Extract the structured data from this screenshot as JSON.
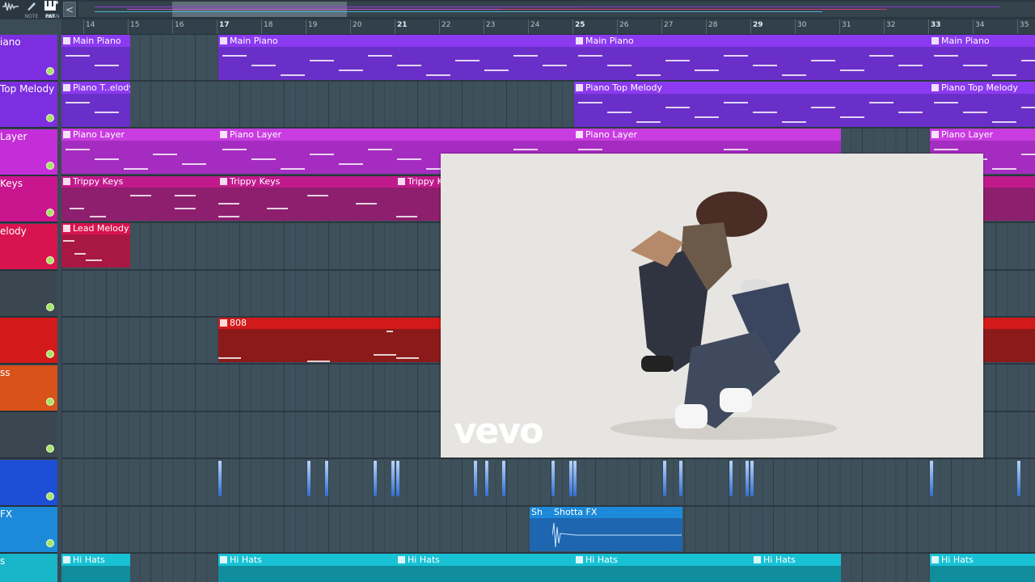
{
  "toolbar": {
    "modes": [
      {
        "key": "wave",
        "caption": "",
        "icon": "waveform-icon"
      },
      {
        "key": "note",
        "caption": "NOTE",
        "icon": "pencil-icon"
      },
      {
        "key": "chan",
        "caption": "CHAN",
        "icon": "link-icon"
      },
      {
        "key": "pat",
        "caption": "PAT",
        "icon": "piano-icon"
      }
    ],
    "scroll_left": "<"
  },
  "ruler": {
    "ticks": [
      "14",
      "15",
      "16",
      "17",
      "18",
      "19",
      "20",
      "21",
      "22",
      "23",
      "24",
      "25",
      "26",
      "27",
      "28",
      "29",
      "30",
      "31",
      "32",
      "33",
      "34",
      "35"
    ],
    "major": [
      "17",
      "21",
      "25",
      "29",
      "33"
    ]
  },
  "tracks": [
    {
      "name": "iano",
      "color": "#7c2ee0"
    },
    {
      "name": "Top Melody",
      "color": "#7c2ee0"
    },
    {
      "name": "Layer",
      "color": "#c42ed8"
    },
    {
      "name": "Keys",
      "color": "#c9168f"
    },
    {
      "name": "elody",
      "color": "#d8144f"
    },
    {
      "name": "",
      "color": "#3a4650"
    },
    {
      "name": "",
      "color": "#d21a1a"
    },
    {
      "name": "ss",
      "color": "#d8521a"
    },
    {
      "name": "",
      "color": "#3a4650"
    },
    {
      "name": "",
      "color": "#1f4ed6"
    },
    {
      "name": "FX",
      "color": "#1c8ad8"
    },
    {
      "name": "s",
      "color": "#18b6c8"
    }
  ],
  "clips": {
    "main_piano": "Main Piano",
    "piano_top_short": "Piano T..elody",
    "piano_top": "Piano Top Melody",
    "piano_layer": "Piano Layer",
    "trippy_keys": "Trippy Keys",
    "trippy_short": "Trippy K",
    "lead_melody": "Lead Melody",
    "b808": "808",
    "shotta_short": "Sh",
    "shotta": "Shotta FX",
    "hi_hats": "Hi  Hats"
  },
  "popup": {
    "logo": "vevo"
  }
}
